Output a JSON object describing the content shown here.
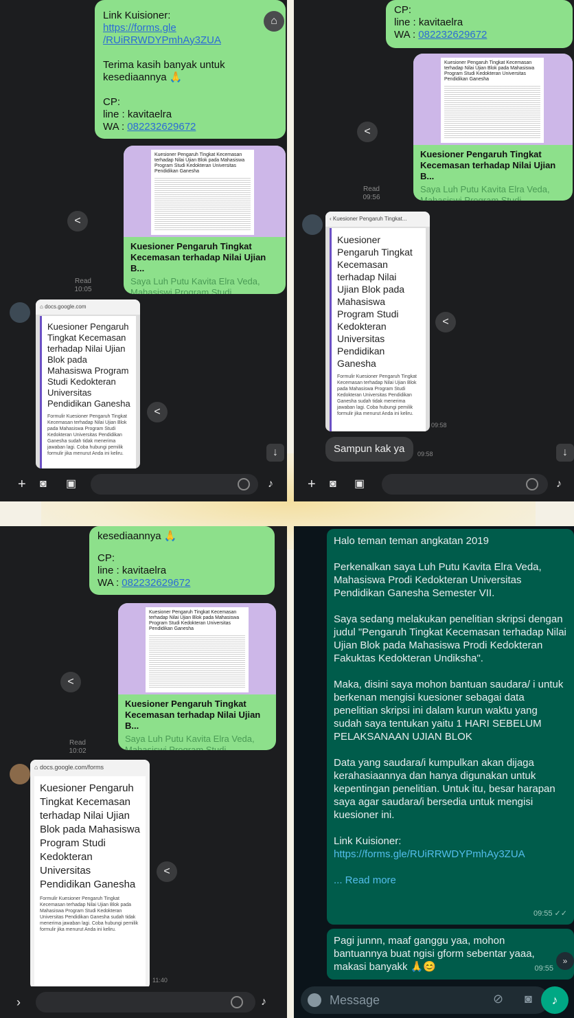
{
  "p1": {
    "link_label": "Link Kuisioner:",
    "link_url_1": "https://forms.gle",
    "link_url_2": "/RUiRRWDYPmhAy3ZUA",
    "thanks_1": "Terima kasih banyak untuk",
    "thanks_2": "kesediaannya 🙏",
    "cp": "CP:",
    "line": "line : kavitaelra",
    "wa_prefix": "WA : ",
    "wa_number": "082232629672",
    "card_doc": "Kuesioner Pengaruh Tingkat Kecemasan terhadap Nilai Ujian Blok pada Mahasiswa Program Studi Kedokteran Universitas Pendidikan Ganesha",
    "card_title": "Kuesioner Pengaruh Tingkat Kecemasan terhadap Nilai Ujian B...",
    "card_sub": "Saya Luh Putu Kavita Elra Veda, Mahasiswi Program Studi Kedoktera...",
    "read": "Read",
    "read_time": "10:05",
    "shot_url": "docs.google.com",
    "shot_big": "Kuesioner Pengaruh Tingkat Kecemasan terhadap Nilai Ujian Blok pada Mahasiswa Program Studi Kedokteran Universitas Pendidikan Ganesha",
    "shot_small": "Formulir Kuesioner Pengaruh Tingkat Kecemasan terhadap Nilai Ujian Blok pada Mahasiswa Program Studi Kedokteran Universitas Pendidikan Ganesha sudah tidak menerima jawaban lagi. Coba hubungi pemilik formulir jika menurut Anda ini keliru."
  },
  "p2": {
    "cp": "CP:",
    "line": "line : kavitaelra",
    "wa_prefix": "WA : ",
    "wa_number": "082232629672",
    "card_doc": "Kuesioner Pengaruh Tingkat Kecemasan terhadap Nilai Ujian Blok pada Mahasiswa Program Studi Kedokteran Universitas Pendidikan Ganesha",
    "card_title": "Kuesioner Pengaruh Tingkat Kecemasan terhadap Nilai Ujian B...",
    "card_sub": "Saya Luh Putu Kavita Elra Veda, Mahasiswi Program Studi Kedoktera...",
    "read": "Read",
    "read_time": "09:56",
    "shot_url": "Kuesioner Pengaruh Tingkat...",
    "shot_big": "Kuesioner Pengaruh Tingkat Kecemasan terhadap Nilai Ujian Blok pada Mahasiswa Program Studi Kedokteran Universitas Pendidikan Ganesha",
    "shot_small": "Formulir Kuesioner Pengaruh Tingkat Kecemasan terhadap Nilai Ujian Blok pada Mahasiswa Program Studi Kedokteran Universitas Pendidikan Ganesha sudah tidak menerima jawaban lagi. Coba hubungi pemilik formulir jika menurut Anda ini keliru.",
    "shot_time": "09:58",
    "reply": "Sampun kak ya",
    "reply_time": "09:58"
  },
  "p3": {
    "thanks_2": "kesediaannya 🙏",
    "cp": "CP:",
    "line": "line : kavitaelra",
    "wa_prefix": "WA : ",
    "wa_number": "082232629672",
    "card_doc": "Kuesioner Pengaruh Tingkat Kecemasan terhadap Nilai Ujian Blok pada Mahasiswa Program Studi Kedokteran Universitas Pendidikan Ganesha",
    "card_title": "Kuesioner Pengaruh Tingkat Kecemasan terhadap Nilai Ujian B...",
    "card_sub": "Saya Luh Putu Kavita Elra Veda, Mahasiswi Program Studi Kedoktera...",
    "read": "Read",
    "read_time": "10:02",
    "shot_url": "docs.google.com/forms",
    "shot_big": "Kuesioner Pengaruh Tingkat Kecemasan terhadap Nilai Ujian Blok pada Mahasiswa Program Studi Kedokteran Universitas Pendidikan Ganesha",
    "shot_small": "Formulir Kuesioner Pengaruh Tingkat Kecemasan terhadap Nilai Ujian Blok pada Mahasiswa Program Studi Kedokteran Universitas Pendidikan Ganesha sudah tidak menerima jawaban lagi. Coba hubungi pemilik formulir jika menurut Anda ini keliru.",
    "shot_time": "11:40"
  },
  "p4": {
    "greeting": "Halo teman teman angkatan 2019",
    "intro": "Perkenalkan saya Luh Putu Kavita Elra Veda, Mahasiswa Prodi Kedokteran Universitas Pendidikan Ganesha Semester VII.",
    "research": "Saya sedang melakukan penelitian skripsi dengan judul \"Pengaruh Tingkat Kecemasan terhadap Nilai Ujian Blok pada Mahasiswa Prodi Kedokteran Fakuktas Kedokteran Undiksha\".",
    "request": "Maka, disini saya mohon bantuan saudara/ i untuk berkenan mengisi kuesioner sebagai data penelitian skripsi ini dalam kurun waktu yang sudah saya tentukan yaitu 1 HARI SEBELUM PELAKSANAAN UJIAN BLOK",
    "privacy": "Data yang saudara/i kumpulkan akan dijaga kerahasiaannya dan hanya digunakan untuk kepentingan penelitian. Untuk itu, besar harapan saya agar saudara/i bersedia untuk mengisi kuesioner ini.",
    "link_label": "Link Kuisioner:",
    "link_url": "https://forms.gle/RUiRRWDYPmhAy3ZUA",
    "read_more": "... Read more",
    "msg_time": "09:55 ✓✓",
    "msg2": "Pagi junnn, maaf ganggu yaa, mohon bantuannya buat ngisi gform sebentar yaaa, makasi banyakk 🙏😊",
    "msg2_time": "09:55",
    "input_placeholder": "Message"
  }
}
